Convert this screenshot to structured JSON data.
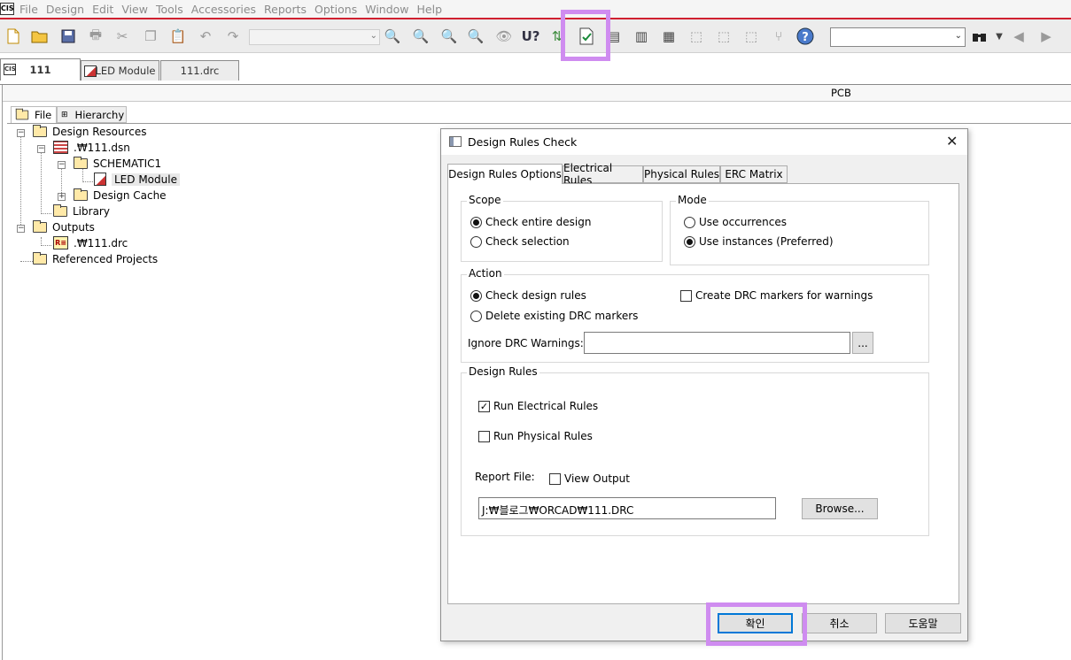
{
  "menubar": {
    "items": [
      "File",
      "Design",
      "Edit",
      "View",
      "Tools",
      "Accessories",
      "Reports",
      "Options",
      "Window",
      "Help"
    ]
  },
  "toolbar": {
    "drc_button": "design-rules-check",
    "search_value": ""
  },
  "doc_tabs": [
    {
      "label": "111",
      "active": true
    },
    {
      "label": "LED Module",
      "active": false
    },
    {
      "label": "111.drc",
      "active": false
    }
  ],
  "project": {
    "view_title": "PCB",
    "panel_tabs": [
      "File",
      "Hierarchy"
    ],
    "tree": {
      "design_resources": "Design Resources",
      "dsn": ".₩111.dsn",
      "schematic": "SCHEMATIC1",
      "page": "LED Module",
      "cache": "Design Cache",
      "library": "Library",
      "outputs": "Outputs",
      "drc_file": ".₩111.drc",
      "referenced": "Referenced Projects"
    }
  },
  "dialog": {
    "title": "Design Rules Check",
    "tabs": [
      "Design Rules Options",
      "Electrical Rules",
      "Physical Rules",
      "ERC Matrix"
    ],
    "scope": {
      "caption": "Scope",
      "opt_entire": "Check entire design",
      "opt_selection": "Check selection",
      "selected": "entire"
    },
    "mode": {
      "caption": "Mode",
      "opt_occurrences": "Use occurrences",
      "opt_instances": "Use instances (Preferred)",
      "selected": "instances"
    },
    "action": {
      "caption": "Action",
      "opt_check": "Check design rules",
      "opt_delete": "Delete existing DRC markers",
      "chk_markers": "Create DRC markers for warnings",
      "ignore_label": "Ignore DRC Warnings:",
      "ignore_value": "",
      "browse_small": "..."
    },
    "design_rules": {
      "caption": "Design Rules",
      "run_electrical": "Run Electrical Rules",
      "run_physical": "Run Physical Rules",
      "report_label": "Report File:",
      "view_output": "View Output",
      "report_path": "J:₩블로그₩ORCAD₩111.DRC",
      "browse": "Browse..."
    },
    "buttons": {
      "ok": "확인",
      "cancel": "취소",
      "help": "도움말"
    }
  },
  "colors": {
    "highlight": "#cf8cf0",
    "menu_line": "#d02030",
    "default_button_border": "#0078d7"
  }
}
